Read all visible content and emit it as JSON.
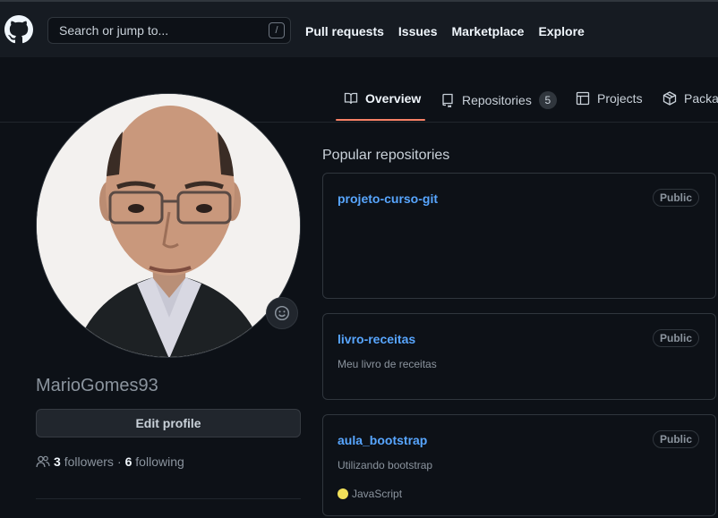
{
  "header": {
    "search_placeholder": "Search or jump to...",
    "search_shortcut": "/",
    "nav": [
      "Pull requests",
      "Issues",
      "Marketplace",
      "Explore"
    ]
  },
  "tabs": [
    {
      "label": "Overview",
      "icon": "book-icon",
      "active": true
    },
    {
      "label": "Repositories",
      "icon": "repo-icon",
      "count": "5"
    },
    {
      "label": "Projects",
      "icon": "table-icon"
    },
    {
      "label": "Packag",
      "icon": "package-icon"
    }
  ],
  "profile": {
    "username": "MarioGomes93",
    "edit_label": "Edit profile",
    "followers_count": "3",
    "followers_label": "followers",
    "separator": "·",
    "following_count": "6",
    "following_label": "following"
  },
  "popular": {
    "title": "Popular repositories",
    "repos": [
      {
        "name": "projeto-curso-git",
        "visibility": "Public",
        "description": "",
        "language": ""
      },
      {
        "name": "livro-receitas",
        "visibility": "Public",
        "description": "Meu livro de receitas",
        "language": ""
      },
      {
        "name": "aula_bootstrap",
        "visibility": "Public",
        "description": "Utilizando bootstrap",
        "language": "JavaScript",
        "language_color": "#f1e05a"
      }
    ]
  },
  "colors": {
    "background": "#0d1117",
    "header_bg": "#161b22",
    "link": "#58a6ff",
    "tab_underline": "#f78166"
  }
}
